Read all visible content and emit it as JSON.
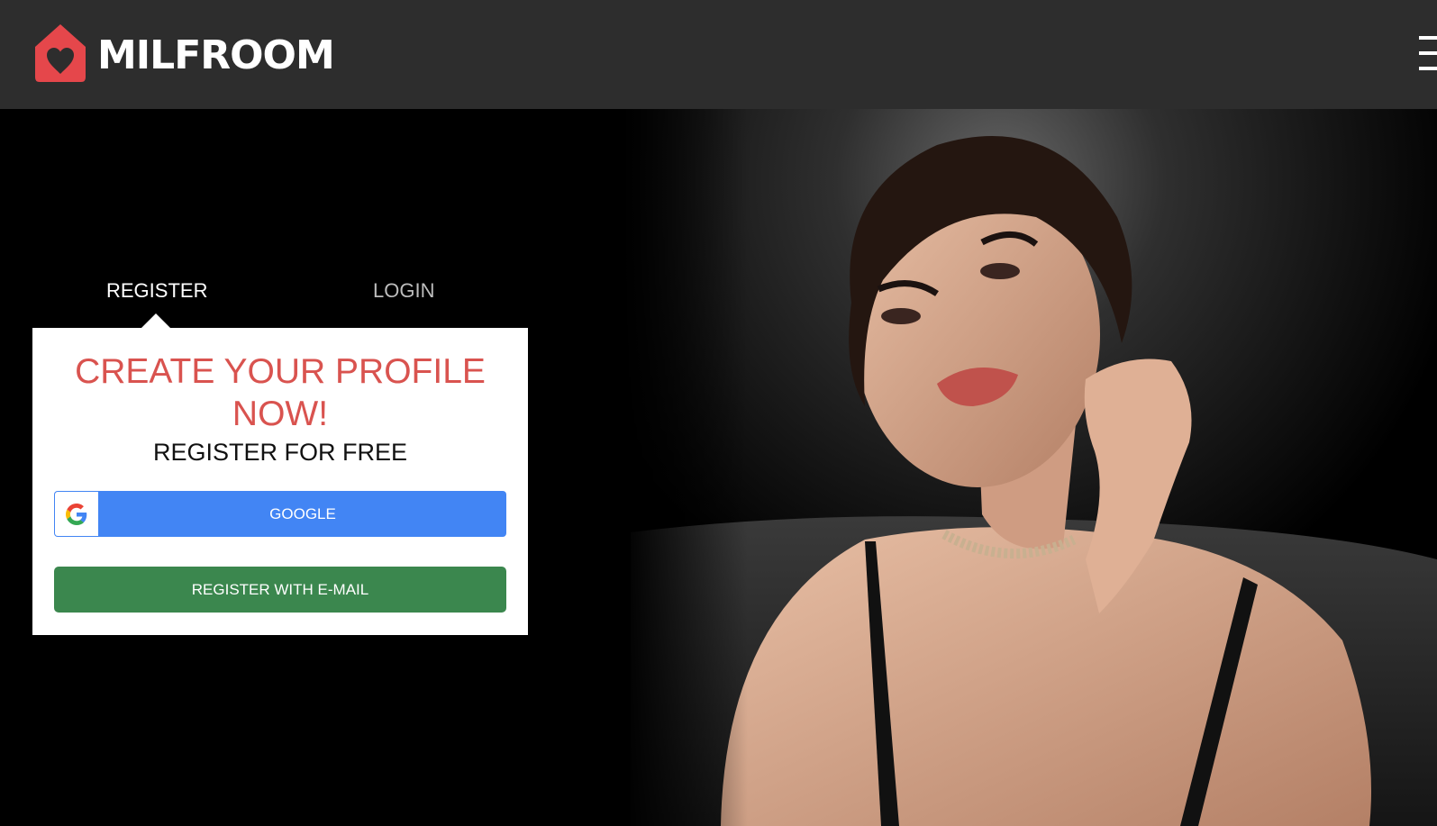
{
  "header": {
    "logo_text": "MILFROOM",
    "brand_color": "#e5474b"
  },
  "auth": {
    "tabs": [
      {
        "label": "REGISTER",
        "active": true
      },
      {
        "label": "LOGIN",
        "active": false
      }
    ],
    "title": "CREATE YOUR PROFILE NOW!",
    "subtitle": "REGISTER FOR FREE",
    "google_button": "GOOGLE",
    "email_button": "REGISTER WITH E-MAIL"
  },
  "colors": {
    "header_bg": "#2d2d2d",
    "title_red": "#d9534f",
    "google_blue": "#4285f4",
    "email_green": "#3b874e"
  },
  "icons": {
    "logo": "house-heart-icon",
    "menu": "hamburger-menu-icon",
    "google": "google-g-icon"
  }
}
